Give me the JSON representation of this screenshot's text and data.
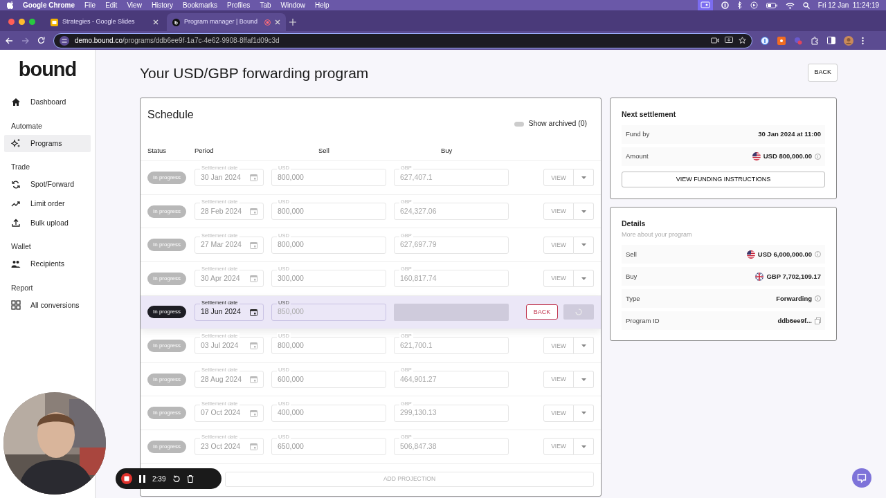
{
  "menu_bar": {
    "app": "Google Chrome",
    "menus": [
      "File",
      "Edit",
      "View",
      "History",
      "Bookmarks",
      "Profiles",
      "Tab",
      "Window",
      "Help"
    ],
    "clock": "Fri 12 Jan  11:24:19"
  },
  "browser": {
    "tabs": [
      {
        "title": "Strategies - Google Slides",
        "selected": false,
        "recording": false
      },
      {
        "title": "Program manager | Bound",
        "selected": true,
        "recording": true
      }
    ],
    "url_host": "demo.bound.co",
    "url_path": "/programs/ddb6ee9f-1a7c-4e62-9908-8ffaf1d09c3d"
  },
  "sidebar": {
    "logo": "bound",
    "sections": [
      {
        "items": [
          {
            "label": "Dashboard",
            "selected": false
          }
        ]
      },
      {
        "heading": "Automate",
        "items": [
          {
            "label": "Programs",
            "selected": true
          }
        ]
      },
      {
        "heading": "Trade",
        "items": [
          {
            "label": "Spot/Forward",
            "selected": false
          },
          {
            "label": "Limit order",
            "selected": false
          },
          {
            "label": "Bulk upload",
            "selected": false
          }
        ]
      },
      {
        "heading": "Wallet",
        "items": [
          {
            "label": "Recipients",
            "selected": false
          }
        ]
      },
      {
        "heading": "Report",
        "items": [
          {
            "label": "All conversions",
            "selected": false
          }
        ]
      }
    ]
  },
  "page": {
    "title": "Your USD/GBP forwarding program",
    "back_button": "BACK"
  },
  "schedule": {
    "title": "Schedule",
    "archive_toggle": {
      "label": "Show archived (0)",
      "on": false
    },
    "columns": [
      "Status",
      "Period",
      "Sell",
      "Buy"
    ],
    "rows": [
      {
        "status": "In progress",
        "date_label": "Settlement date",
        "date": "30 Jan 2024",
        "sell_label": "USD",
        "sell": "800,000",
        "buy_label": "GBP",
        "buy": "627,407.1",
        "editing": false,
        "action": "VIEW"
      },
      {
        "status": "In progress",
        "date_label": "Settlement date",
        "date": "28 Feb 2024",
        "sell_label": "USD",
        "sell": "800,000",
        "buy_label": "GBP",
        "buy": "624,327.06",
        "editing": false,
        "action": "VIEW"
      },
      {
        "status": "In progress",
        "date_label": "Settlement date",
        "date": "27 Mar 2024",
        "sell_label": "USD",
        "sell": "800,000",
        "buy_label": "GBP",
        "buy": "627,697.79",
        "editing": false,
        "action": "VIEW"
      },
      {
        "status": "In progress",
        "date_label": "Settlement date",
        "date": "30 Apr 2024",
        "sell_label": "USD",
        "sell": "300,000",
        "buy_label": "GBP",
        "buy": "160,817.74",
        "editing": false,
        "action": "VIEW"
      },
      {
        "status": "In progress",
        "date_label": "Settlement date",
        "date": "18 Jun 2024",
        "sell_label": "USD",
        "sell": "850,000",
        "editing": true,
        "action": "BACK"
      },
      {
        "status": "In progress",
        "date_label": "Settlement date",
        "date": "03 Jul 2024",
        "sell_label": "USD",
        "sell": "800,000",
        "buy_label": "GBP",
        "buy": "621,700.1",
        "editing": false,
        "action": "VIEW"
      },
      {
        "status": "In progress",
        "date_label": "Settlement date",
        "date": "28 Aug 2024",
        "sell_label": "USD",
        "sell": "600,000",
        "buy_label": "GBP",
        "buy": "464,901.27",
        "editing": false,
        "action": "VIEW"
      },
      {
        "status": "In progress",
        "date_label": "Settlement date",
        "date": "07 Oct 2024",
        "sell_label": "USD",
        "sell": "400,000",
        "buy_label": "GBP",
        "buy": "299,130.13",
        "editing": false,
        "action": "VIEW"
      },
      {
        "status": "In progress",
        "date_label": "Settlement date",
        "date": "23 Oct 2024",
        "sell_label": "USD",
        "sell": "650,000",
        "buy_label": "GBP",
        "buy": "506,847.38",
        "editing": false,
        "action": "VIEW"
      }
    ],
    "add_button": "ADD PROJECTION"
  },
  "next_settlement": {
    "title": "Next settlement",
    "rows": [
      {
        "label": "Fund by",
        "value": "30 Jan 2024 at 11:00"
      },
      {
        "label": "Amount",
        "value": "USD 800,000.00",
        "kind": "usd"
      }
    ],
    "button": "VIEW FUNDING INSTRUCTIONS"
  },
  "details": {
    "title": "Details",
    "subtitle": "More about your program",
    "rows": [
      {
        "label": "Sell",
        "value": "USD 6,000,000.00",
        "kind": "usd"
      },
      {
        "label": "Buy",
        "value": "GBP 7,702,109.17",
        "kind": "gbp"
      },
      {
        "label": "Type",
        "value": "Forwarding",
        "kind": "info"
      },
      {
        "label": "Program ID",
        "value": "ddb6ee9f...",
        "kind": "copy"
      }
    ]
  },
  "recorder": {
    "timer": "2:39"
  }
}
